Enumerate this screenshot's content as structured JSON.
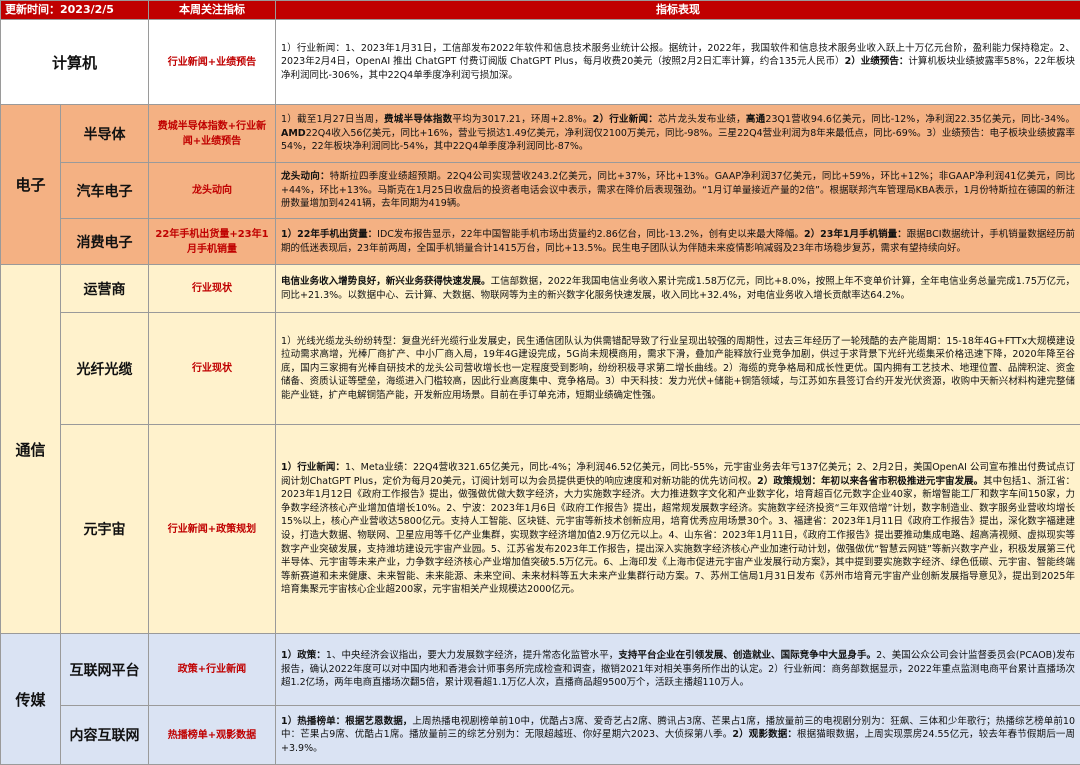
{
  "header": {
    "update_time": "更新时间：2023/2/5",
    "indicator": "本周关注指标",
    "performance": "指标表现"
  },
  "colors": {
    "header": "#c00000",
    "indicator_text": "#c00000",
    "computer": "#ffffff",
    "electronics": "#f4b183",
    "telecom": "#fff2cc",
    "media": "#dae3f3"
  },
  "computer": {
    "category": "计算机",
    "indicator": "行业新闻+业绩预告",
    "p1": "1）行业新闻：1、2023年1月31日，工信部发布2022年软件和信息技术服务业统计公报。据统计，2022年，我国软件和信息技术服务业收入跃上十万亿元台阶，盈利能力保持稳定。2、2023年2月4日，OpenAI 推出 ChatGPT 付费订阅版 ChatGPT Plus，每月收费20美元（按照2月2日汇率计算，约合135元人民币）",
    "p2_label": "2）业绩预告：",
    "p2": "计算机板块业绩披露率58%，22年板块净利润同比-306%，其中22Q4单季度净利润亏损加深。"
  },
  "electronics": {
    "category": "电子",
    "semi": {
      "name": "半导体",
      "indicator": "费城半导体指数+行业新闻+业绩预告",
      "t1": "1）截至1月27日当周，",
      "t1b": "费城半导体指数",
      "t2": "平均为3017.21，环周+2.8%。",
      "t3b": "2）行业新闻：",
      "t4": "芯片龙头发布业绩，",
      "t4b": "高通",
      "t5": "23Q1营收94.6亿美元，同比-12%，净利润22.35亿美元，同比-34%。",
      "t5b": "AMD",
      "t6": "22Q4收入56亿美元，同比+16%，营业亏损达1.49亿美元，净利润仅2100万美元，同比-98%。三星22Q4营业利润为8年来最低点，同比-69%。3）业绩预告：电子板块业绩披露率54%，22年板块净利润同比-54%，其中22Q4单季度净利润同比-87%。"
    },
    "auto": {
      "name": "汽车电子",
      "indicator": "龙头动向",
      "t1b": "龙头动向：",
      "t1": "特斯拉四季度业绩超预期。22Q4公司实现营收243.2亿美元，同比+37%，环比+13%。GAAP净利润37亿美元，同比+59%，环比+12%；非GAAP净利润41亿美元，同比+44%，环比+13%。马斯克在1月25日收盘后的投资者电话会议中表示，需求在降价后表现强劲。“1月订单量接近产量的2倍”。根据联邦汽车管理局KBA表示，1月份特斯拉在德国的新注册数量增加到4241辆，去年同期为419辆。"
    },
    "consumer": {
      "name": "消费电子",
      "indicator": "22年手机出货量+23年1月手机销量",
      "t1b": "1）22年手机出货量：",
      "t1": "IDC发布报告显示，22年中国智能手机市场出货量约2.86亿台，同比-13.2%，创有史以来最大降幅。",
      "t2b": "2）23年1月手机销量：",
      "t2": "跟据BCI数据统计，手机销量数据经历前期的低迷表现后，23年前两周，全国手机销量合计1415万台，同比+13.5%。民生电子团队认为伴随未来疫情影响减弱及23年市场稳步复苏，需求有望持续向好。"
    }
  },
  "telecom": {
    "category": "通信",
    "operator": {
      "name": "运营商",
      "indicator": "行业现状",
      "t1b": "电信业务收入增势良好，新兴业务获得快速发展。",
      "t1": "工信部数据，2022年我国电信业务收入累计完成1.58万亿元，同比+8.0%，按照上年不变单价计算，全年电信业务总量完成1.75万亿元，同比+21.3%。以数据中心、云计算、大数据、物联网等为主的新兴数字化服务快速发展，收入同比+32.4%，对电信业务收入增长贡献率达64.2%。"
    },
    "fiber": {
      "name": "光纤光缆",
      "indicator": "行业现状",
      "t1": "1）光线光缆龙头纷纷转型：复盘光纤光缆行业发展史，民生通信团队认为供需错配导致了行业呈现出较强的周期性，过去三年经历了一轮残酷的去产能周期：15-18年4G+FTTx大规模建设拉动需求高增，光棒厂商扩产、中小厂商入局，19年4G建设完成，5G尚未规模商用，需求下滑，叠加产能释放行业竞争加剧，供过于求背景下光纤光缆集采价格迅速下降，2020年降至谷底，国内三家拥有光棒自研技术的龙头公司营收增长也一定程度受到影响，纷纷积极寻求第二增长曲线。2）海缆的竞争格局和成长性更优。国内拥有工艺技术、地理位置、品牌积淀、资金储备、资质认证等壁垒，海缆进入门槛较高，因此行业高度集中、竞争格局。3）中天科技：发力光伏+储能+铜箔领域，与江苏如东县签订合约开发光伏资源，收购中天新兴材料构建完整储能产业链，扩产电解铜箔产能，开发新应用场景。目前在手订单充沛，短期业绩确定性强。"
    },
    "metaverse": {
      "name": "元宇宙",
      "indicator": "行业新闻+政策规划",
      "t1b": "1）行业新闻：",
      "t1": "1、Meta业绩：22Q4营收321.65亿美元，同比-4%；净利润46.52亿美元，同比-55%，元宇宙业务去年亏137亿美元；2、2月2日，美国OpenAI 公司宣布推出付费试点订阅计划ChatGPT Plus，定价为每月20美元，订阅计划可以为会员提供更快的响应速度和对新功能的优先访问权。",
      "t2b": "2）政策规划：年初以来各省市积极推进元宇宙发展。",
      "t2": "其中包括1、浙江省：2023年1月12日《政府工作报告》提出，做强做优做大数字经济，大力实施数字经济。大力推进数字文化和产业数字化，培育超百亿元数字企业40家，新增智能工厂和数字车间150家，力争数字经济核心产业增加值增长10%。2、宁波：2023年1月6日《政府工作报告》提出，超常规发展数字经济。实施数字经济投资“三年双倍增”计划，数字制造业、数字服务业营收均增长15%以上，核心产业营收达5800亿元。支持人工智能、区块链、元宇宙等新技术创新应用，培育优秀应用场景30个。3、福建省：2023年1月11日《政府工作报告》提出，深化数字福建建设，打造大数据、物联网、卫星应用等千亿产业集群，实现数字经济增加值2.9万亿元以上。4、山东省：2023年1月11日，《政府工作报告》提出要推动集成电路、超高清视频、虚拟现实等数字产业突破发展，支持潍坊建设元宇宙产业园。5、江苏省发布2023年工作报告，提出深入实施数字经济核心产业加速行动计划，做强做优“智慧云网链”等新兴数字产业，积极发展第三代半导体、元宇宙等未来产业，力争数字经济核心产业增加值突破5.5万亿元。6、上海印发《上海市促进元宇宙产业发展行动方案》，其中提到要实施数字经济、绿色低碳、元宇宙、智能终端等新赛道和未来健康、未来智能、未来能源、未来空间、未来材料等五大未来产业集群行动方案。7、苏州工信局1月31日发布《苏州市培育元宇宙产业创新发展指导意见》，提出到2025年培育集聚元宇宙核心企业超200家，元宇宙相关产业规模达2000亿元。"
    }
  },
  "media": {
    "category": "传媒",
    "internet": {
      "name": "互联网平台",
      "indicator": "政策+行业新闻",
      "t1b": "1）政策：",
      "t1": "1、中央经济会议指出，要大力发展数字经济，提升常态化监管水平，",
      "t1b2": "支持平台企业在引领发展、创造就业、国际竞争中大显身手。",
      "t2": "2、美国公众公司会计监督委员会(PCAOB)发布报告，确认2022年度可以对中国内地和香港会计师事务所完成检查和调查，撤销2021年对相关事务所作出的认定。2）行业新闻：商务部数据显示，2022年重点监测电商平台累计直播场次超1.2亿场，两年电商直播场次翻5倍，累计观看超1.1万亿人次，直播商品超9500万个，活跃主播超110万人。"
    },
    "content": {
      "name": "内容互联网",
      "indicator": "热播榜单+观影数据",
      "t1b": "1）热播榜单：根据艺恩数据，",
      "t1": "上周热播电视剧榜单前10中，优酷占3席、爱奇艺占2席、腾讯占3席、芒果占1席，播放量前三的电视剧分别为：狂飙、三体和少年歌行；热播综艺榜单前10中：芒果占9席、优酷占1席。播放量前三的综艺分别为：无限超越班、你好星期六2023、大侦探第八季。",
      "t2b": "2）观影数据：",
      "t2": "根据猫眼数据，上周实现票房24.55亿元，较去年春节假期后一周+3.9%。"
    }
  }
}
